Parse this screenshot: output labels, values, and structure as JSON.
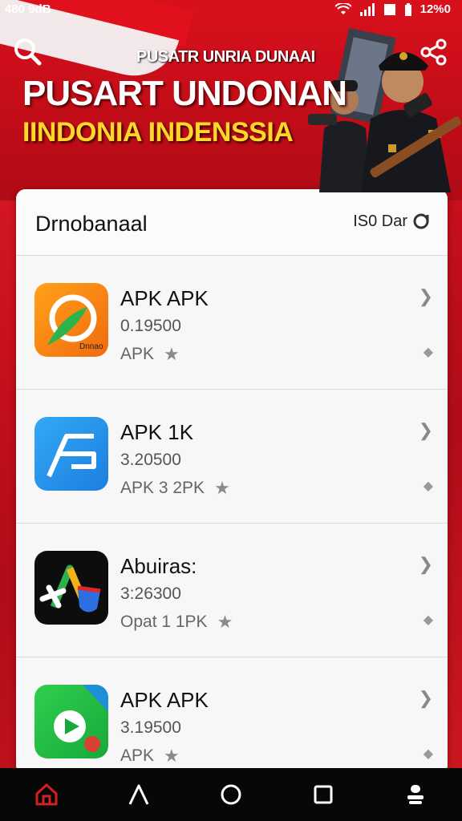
{
  "status_bar": {
    "time_text": "480 9dB",
    "battery_text": "12%0"
  },
  "banner": {
    "subtitle": "PUSATR UNRIA DUNAAI",
    "title": "PUSART UNDONAN",
    "title_line2": "IINDONIA  INDENSSIA"
  },
  "list_header": {
    "title": "Drnobanaal",
    "filter_text": "IS0 Dar"
  },
  "apps": [
    {
      "name": "APK APK",
      "version": "0.19500",
      "meta": "APK",
      "icon": "orange-circle-leaf-icon",
      "icon_label": "Dnnao"
    },
    {
      "name": "APK 1K",
      "version": "3.20500",
      "meta": "APK 3 2PK",
      "icon": "blue-line-icon"
    },
    {
      "name": "Abuiras:",
      "version": "3:26300",
      "meta": "Opat 1 1PK",
      "icon": "dark-triangle-shield-icon"
    },
    {
      "name": "APK APK",
      "version": "3.19500",
      "meta": "APK",
      "icon": "green-play-icon"
    }
  ],
  "colors": {
    "banner_red": "#d8101c",
    "title_yellow": "#ffd62a",
    "card_bg": "#f7f7f7",
    "nav_bg": "#070707",
    "home_active": "#d32020"
  },
  "nav": [
    "home-icon",
    "triangle-back-icon",
    "circle-home-icon",
    "square-recents-icon",
    "person-icon"
  ]
}
